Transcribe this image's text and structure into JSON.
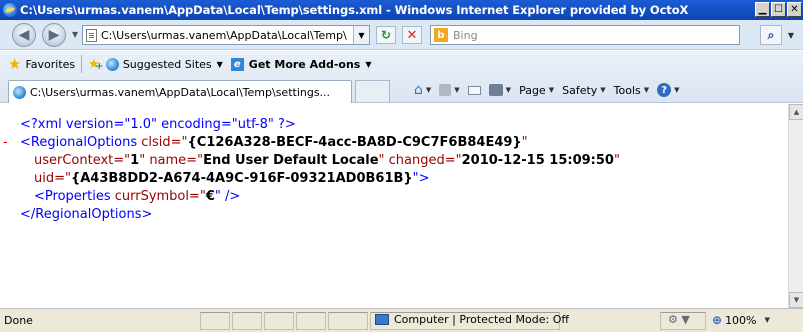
{
  "window": {
    "title": "C:\\Users\\urmas.vanem\\AppData\\Local\\Temp\\settings.xml - Windows Internet Explorer provided by OctoX",
    "controls": {
      "minimize": "▁",
      "maximize": "☐",
      "close": "✕"
    }
  },
  "address_bar": {
    "url": "C:\\Users\\urmas.vanem\\AppData\\Local\\Temp\\settings.xml",
    "search_placeholder": "Bing"
  },
  "favorites_bar": {
    "favorites_label": "Favorites",
    "suggested_sites_label": "Suggested Sites",
    "get_more_addons_label": "Get More Add-ons"
  },
  "tab": {
    "title": "C:\\Users\\urmas.vanem\\AppData\\Local\\Temp\\settings..."
  },
  "command_bar": {
    "page_label": "Page",
    "safety_label": "Safety",
    "tools_label": "Tools"
  },
  "xml": {
    "declaration": "<?xml version=\"1.0\" encoding=\"utf-8\" ?>",
    "collapse_marker": "-",
    "line2_open": "<RegionalOptions",
    "line2_attr": " clsid=\"",
    "line2_value": "{C126A328-BECF-4acc-BA8D-C9C7F6B84E49}",
    "line2_close": "\"",
    "line3_attr1": "userContext=\"",
    "line3_value1": "1",
    "line3_attr2": "\" name=\"",
    "line3_value2": "End User Default Locale",
    "line3_attr3": "\" changed=\"",
    "line3_value3": "2010-12-15 15:09:50",
    "line3_end": "\"",
    "line4_attr": "uid=\"",
    "line4_value": "{A43B8DD2-A674-4A9C-916F-09321AD0B61B}",
    "line4_end": "\">",
    "line5_open": "<Properties",
    "line5_attr": " currSymbol=\"",
    "line5_value": "€",
    "line5_end": "\" />",
    "line6": "</RegionalOptions>"
  },
  "status_bar": {
    "status_text": "Done",
    "zone_text": "Computer | Protected Mode: Off",
    "zoom_text": "100%"
  }
}
